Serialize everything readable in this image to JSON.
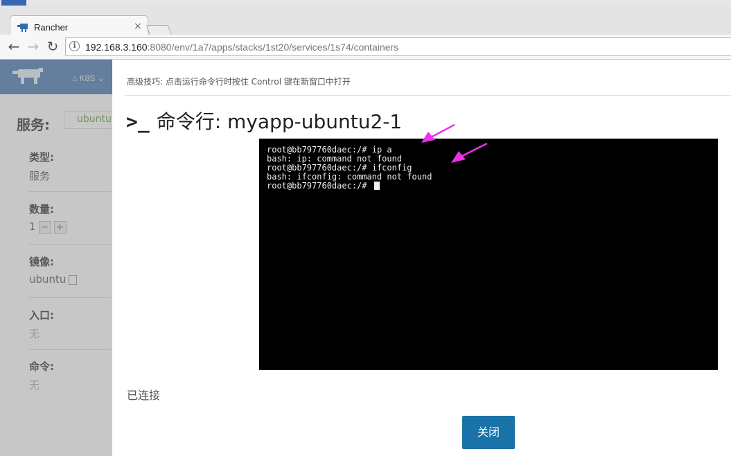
{
  "browser": {
    "tab_title": "Rancher",
    "url_host": "192.168.3.160",
    "url_rest": ":8080/env/1a7/apps/stacks/1st20/services/1s74/containers"
  },
  "app": {
    "nav_label": "K8S",
    "service_title": "服务:",
    "service_chip": "ubuntu",
    "fields": [
      {
        "label": "类型:",
        "value": "服务"
      },
      {
        "label": "数量:",
        "value": "1"
      },
      {
        "label": "镜像:",
        "value": "ubuntu"
      },
      {
        "label": "入口:",
        "value": "无"
      },
      {
        "label": "命令:",
        "value": "无"
      }
    ]
  },
  "modal": {
    "tip": "高级技巧: 点击运行命令行时按住 Control 键在新窗口中打开",
    "title": "命令行: myapp-ubuntu2-1",
    "title_icon": ">_",
    "terminal_lines": [
      "root@bb797760daec:/# ip a",
      "bash: ip: command not found",
      "root@bb797760daec:/# ifconfig",
      "bash: ifconfig: command not found",
      "root@bb797760daec:/# "
    ],
    "status": "已连接",
    "close_label": "关闭"
  },
  "colors": {
    "accent": "#1a73a8",
    "header": "#4a7cb3",
    "annotation_arrow": "#e832e8"
  }
}
